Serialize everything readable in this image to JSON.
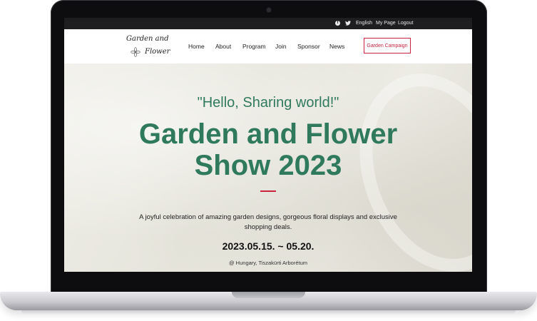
{
  "topbar": {
    "facebook_icon": "facebook-icon",
    "twitter_icon": "twitter-icon",
    "language": "English",
    "my_page": "My Page",
    "logout": "Logout"
  },
  "logo": {
    "line1": "Garden and",
    "line2": "Flower"
  },
  "nav": {
    "home": "Home",
    "about": "About",
    "program": "Program",
    "join": "Join",
    "sponsor": "Sponsor",
    "news": "News",
    "campaign": "Garden Campaign"
  },
  "hero": {
    "tagline": "\"Hello, Sharing world!\"",
    "title_line1": "Garden and Flower",
    "title_line2": "Show 2023",
    "description": "A joyful celebration of amazing garden designs, gorgeous floral displays and exclusive shopping deals.",
    "dates": "2023.05.15. ~ 05.20.",
    "venue": "@ Hungary, Tiszakürti Arborétum"
  },
  "colors": {
    "accent_green": "#2f7a5d",
    "accent_red": "#c8233f",
    "topbar_bg": "#1e1e20"
  }
}
